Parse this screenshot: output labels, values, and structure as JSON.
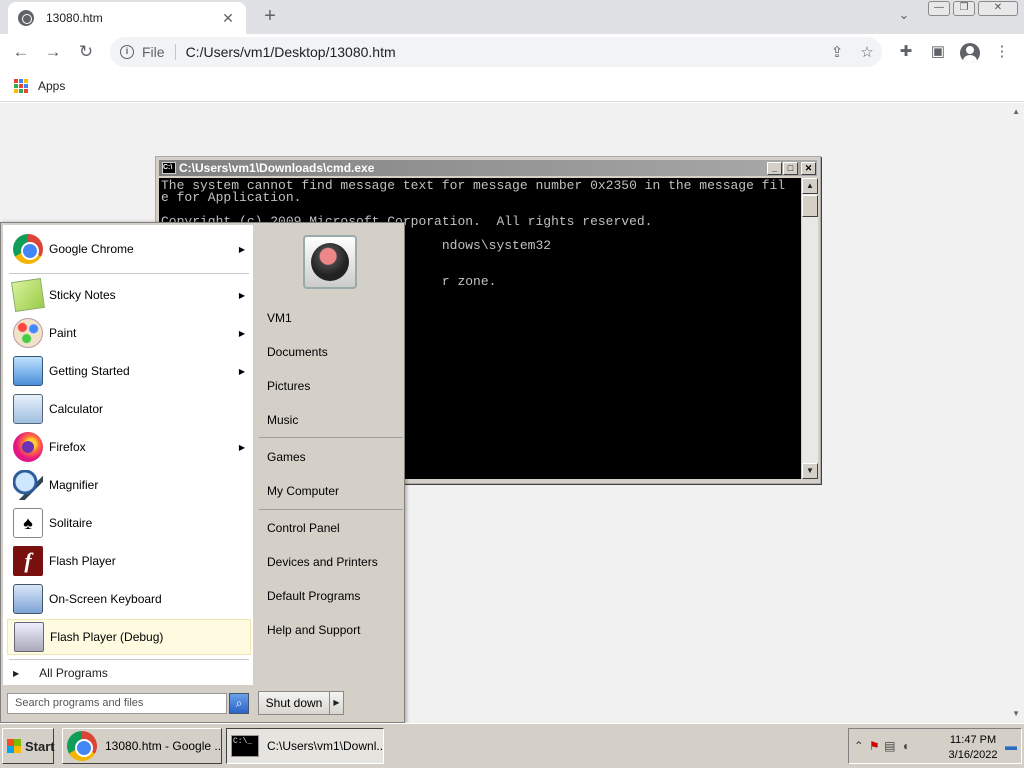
{
  "browser": {
    "tab_title": "13080.htm",
    "new_tab_glyph": "+",
    "url_scheme": "File",
    "url": "C:/Users/vm1/Desktop/13080.htm",
    "bookmarks": {
      "apps_label": "Apps"
    },
    "icons": [
      "back-icon",
      "forward-icon",
      "reload-icon",
      "info-icon",
      "share-icon",
      "star-icon",
      "extensions-icon",
      "side-panel-icon",
      "profile-icon",
      "menu-icon",
      "tab-search-icon"
    ]
  },
  "cmd": {
    "title": "C:\\Users\\vm1\\Downloads\\cmd.exe",
    "lines": [
      "The system cannot find message text for message number 0x2350 in the message fil",
      "e for Application.",
      "",
      "Copyright (c) 2009 Microsoft Corporation.  All rights reserved.",
      "",
      "                                    ndows\\system32",
      "",
      "",
      "                                    r zone."
    ]
  },
  "start_menu": {
    "programs": [
      {
        "label": "Google Chrome",
        "icon": "chrome-icon",
        "has_submenu": true
      },
      {
        "label": "Sticky Notes",
        "icon": "sticky-notes-icon",
        "has_submenu": true
      },
      {
        "label": "Paint",
        "icon": "paint-icon",
        "has_submenu": true
      },
      {
        "label": "Getting Started",
        "icon": "getting-started-icon",
        "has_submenu": true
      },
      {
        "label": "Calculator",
        "icon": "calculator-icon",
        "has_submenu": false
      },
      {
        "label": "Firefox",
        "icon": "firefox-icon",
        "has_submenu": true
      },
      {
        "label": "Magnifier",
        "icon": "magnifier-icon",
        "has_submenu": false
      },
      {
        "label": "Solitaire",
        "icon": "solitaire-icon",
        "has_submenu": false
      },
      {
        "label": "Flash Player",
        "icon": "flash-player-icon",
        "has_submenu": false
      },
      {
        "label": "On-Screen Keyboard",
        "icon": "keyboard-icon",
        "has_submenu": false
      },
      {
        "label": "Flash Player (Debug)",
        "icon": "flash-debug-icon",
        "has_submenu": false,
        "highlighted": true
      }
    ],
    "all_programs": "All Programs",
    "search_placeholder": "Search programs and files",
    "right_links": [
      {
        "label": "VM1"
      },
      {
        "label": "Documents"
      },
      {
        "label": "Pictures"
      },
      {
        "label": "Music"
      },
      {
        "label": "Games"
      },
      {
        "label": "My Computer"
      },
      {
        "label": "Control Panel"
      },
      {
        "label": "Devices and Printers"
      },
      {
        "label": "Default Programs"
      },
      {
        "label": "Help and Support"
      }
    ],
    "shutdown_label": "Shut down"
  },
  "taskbar": {
    "start_label": "Start",
    "buttons": [
      {
        "label": "13080.htm - Google ...",
        "icon": "chrome-icon"
      },
      {
        "label": "C:\\Users\\vm1\\Downl...",
        "icon": "cmd-icon"
      }
    ],
    "clock_time": "11:47 PM",
    "clock_date": "3/16/2022"
  },
  "colors": {
    "chrome_tabstrip": "#dfe1e5",
    "page_background": "#f1f1f1",
    "classic_face": "#d4d0c8",
    "highlight": "#fffbe0"
  }
}
